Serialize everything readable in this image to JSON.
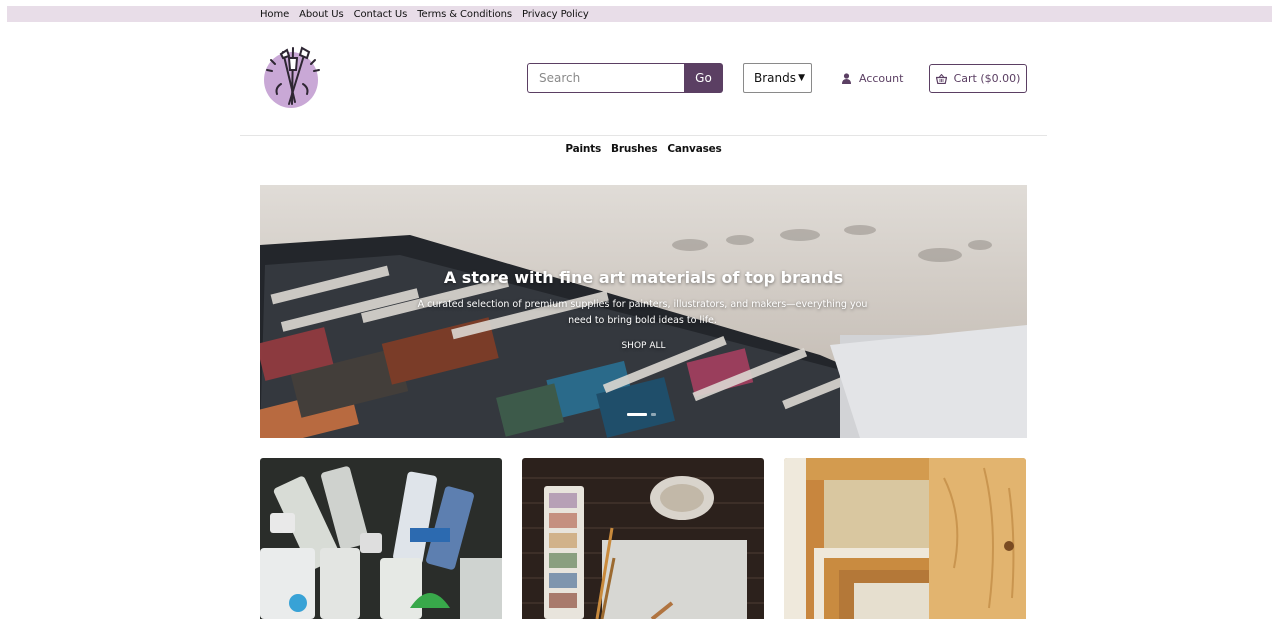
{
  "top_nav": {
    "links": [
      "Home",
      "About Us",
      "Contact Us",
      "Terms & Conditions",
      "Privacy Policy"
    ]
  },
  "header": {
    "search": {
      "placeholder": "Search",
      "button_label": "Go"
    },
    "brands_select": {
      "selected": "Brands"
    },
    "account_label": "Account",
    "cart_label": "Cart ($0.00)"
  },
  "category_nav": {
    "links": [
      "Paints",
      "Brushes",
      "Canvases"
    ]
  },
  "hero": {
    "title": "A store with fine art materials of top brands",
    "subtitle": "A curated selection of premium supplies for painters, illustrators, and makers—everything you need to bring bold ideas to life.",
    "cta_label": "SHOP ALL",
    "slide_count": 2,
    "active_slide": 1
  },
  "category_tiles": [
    "paint-tubes-image",
    "watercolor-palette-image",
    "canvas-frames-image"
  ],
  "colors": {
    "accent": "#5b3f63",
    "topbar": "#e8dde8"
  }
}
